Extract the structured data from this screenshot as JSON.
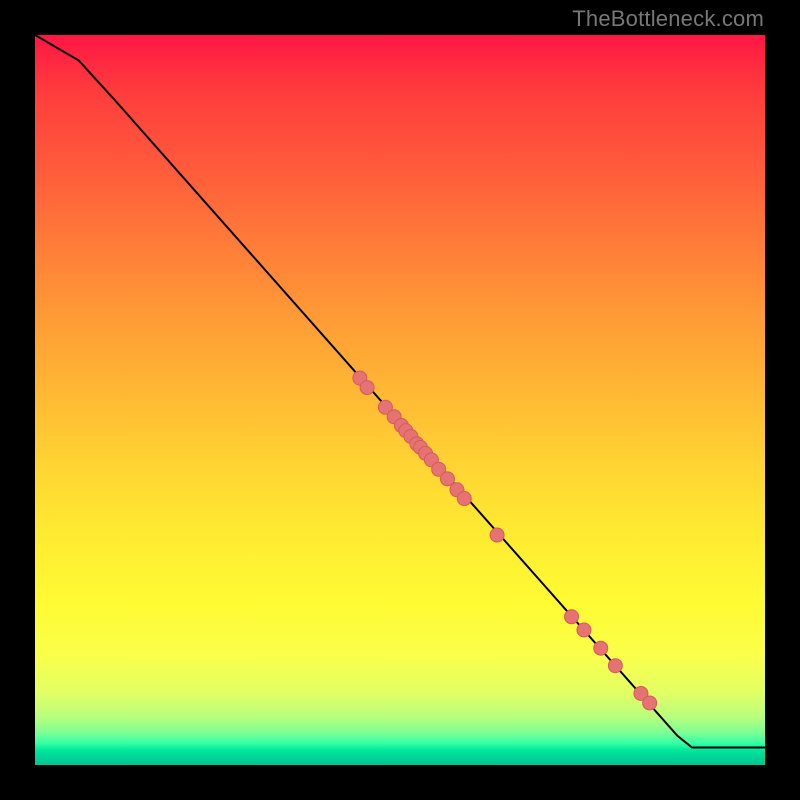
{
  "watermark": "TheBottleneck.com",
  "chart_data": {
    "type": "line",
    "title": "",
    "xlabel": "",
    "ylabel": "",
    "grid": false,
    "legend": false,
    "xlim": [
      0,
      100
    ],
    "ylim": [
      0,
      100
    ],
    "background_gradient": {
      "top": "#ff1744",
      "mid": "#ffe234",
      "bottom": "#00c58f"
    },
    "curve": {
      "name": "main-curve",
      "color": "#000000",
      "points_xy": [
        [
          0,
          100
        ],
        [
          6,
          96.5
        ],
        [
          11,
          91
        ],
        [
          88,
          4
        ],
        [
          90,
          2.4
        ],
        [
          100,
          2.4
        ]
      ]
    },
    "markers": {
      "name": "scatter-points",
      "color": "#e57373",
      "stroke": "#d85a5a",
      "points_xy": [
        [
          44.5,
          53.0
        ],
        [
          45.5,
          51.7
        ],
        [
          48.0,
          49.0
        ],
        [
          49.2,
          47.7
        ],
        [
          50.2,
          46.5
        ],
        [
          50.8,
          45.8
        ],
        [
          51.5,
          45.0
        ],
        [
          52.3,
          44.0
        ],
        [
          52.8,
          43.5
        ],
        [
          53.5,
          42.7
        ],
        [
          54.3,
          41.8
        ],
        [
          55.3,
          40.5
        ],
        [
          56.5,
          39.2
        ],
        [
          57.8,
          37.7
        ],
        [
          58.8,
          36.5
        ],
        [
          63.3,
          31.5
        ],
        [
          73.5,
          20.3
        ],
        [
          75.2,
          18.5
        ],
        [
          77.5,
          16.0
        ],
        [
          79.5,
          13.6
        ],
        [
          83.0,
          9.8
        ],
        [
          84.2,
          8.5
        ]
      ]
    }
  }
}
